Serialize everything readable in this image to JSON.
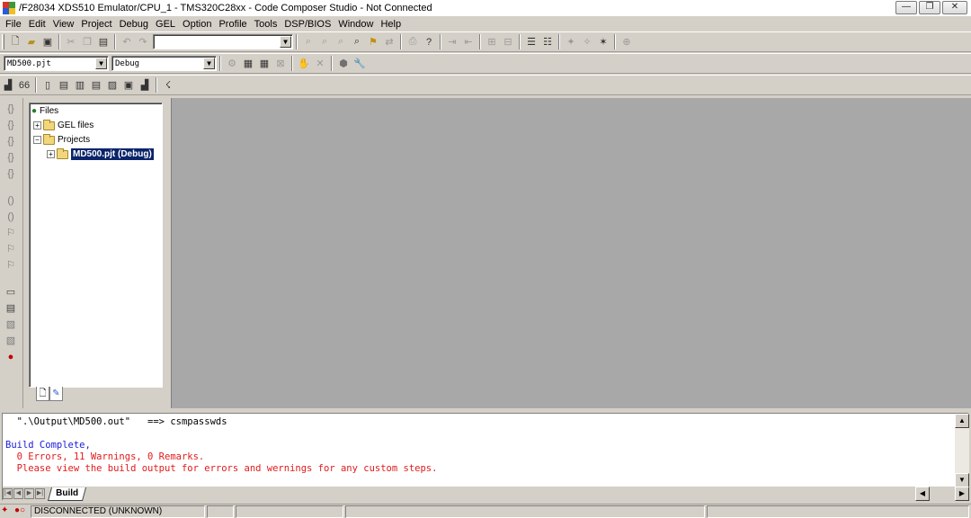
{
  "window": {
    "title": "/F28034 XDS510 Emulator/CPU_1 - TMS320C28xx - Code Composer Studio - Not Connected",
    "controls": {
      "minimize": "—",
      "maximize": "❐",
      "close": "✕"
    }
  },
  "menu": [
    "File",
    "Edit",
    "View",
    "Project",
    "Debug",
    "GEL",
    "Option",
    "Profile",
    "Tools",
    "DSP/BIOS",
    "Window",
    "Help"
  ],
  "toolbar": {
    "project_combo": "MD500.pjt",
    "config_combo": "Debug",
    "find_combo": ""
  },
  "project_tree": {
    "root": "Files",
    "gel": "GEL files",
    "projects": "Projects",
    "project": "MD500.pjt (Debug)"
  },
  "output": {
    "lines": [
      {
        "text": "  \".\\Output\\MD500.out\"   ==> csmpasswds",
        "color": "black"
      },
      {
        "text": "",
        "color": "black"
      },
      {
        "text": "Build Complete,",
        "color": "blue"
      },
      {
        "text": "  0 Errors, 11 Warnings, 0 Remarks.",
        "color": "red"
      },
      {
        "text": "  Please view the build output for errors and wernings for any custom steps.",
        "color": "red"
      }
    ],
    "tab": "Build"
  },
  "status": {
    "connection": "DISCONNECTED (UNKNOWN)"
  },
  "colors": {
    "selection": "#0a246a",
    "workspace": "#a8a8a8",
    "output_blue": "#1a1ad8",
    "output_red": "#e21a1a"
  }
}
